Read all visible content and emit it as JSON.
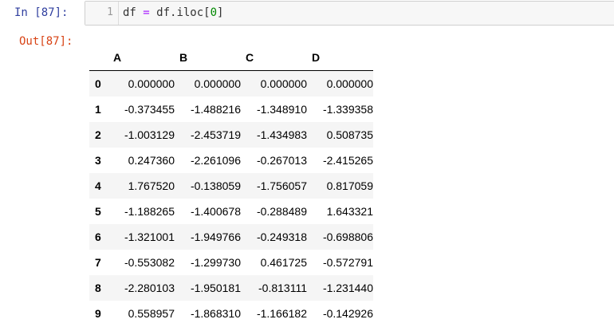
{
  "input_cell": {
    "prompt": "In  [87]:",
    "line_number": "1",
    "code": {
      "part1": "df ",
      "op": "=",
      "part2": " df.iloc[",
      "num": "0",
      "part3": "]"
    }
  },
  "output_cell": {
    "prompt": "Out[87]:",
    "dataframe": {
      "columns": [
        "A",
        "B",
        "C",
        "D"
      ],
      "rows": [
        {
          "index": "0",
          "values": [
            "0.000000",
            "0.000000",
            "0.000000",
            "0.000000"
          ]
        },
        {
          "index": "1",
          "values": [
            "-0.373455",
            "-1.488216",
            "-1.348910",
            "-1.339358"
          ]
        },
        {
          "index": "2",
          "values": [
            "-1.003129",
            "-2.453719",
            "-1.434983",
            "0.508735"
          ]
        },
        {
          "index": "3",
          "values": [
            "0.247360",
            "-2.261096",
            "-0.267013",
            "-2.415265"
          ]
        },
        {
          "index": "4",
          "values": [
            "1.767520",
            "-0.138059",
            "-1.756057",
            "0.817059"
          ]
        },
        {
          "index": "5",
          "values": [
            "-1.188265",
            "-1.400678",
            "-0.288489",
            "1.643321"
          ]
        },
        {
          "index": "6",
          "values": [
            "-1.321001",
            "-1.949766",
            "-0.249318",
            "-0.698806"
          ]
        },
        {
          "index": "7",
          "values": [
            "-0.553082",
            "-1.299730",
            "0.461725",
            "-0.572791"
          ]
        },
        {
          "index": "8",
          "values": [
            "-2.280103",
            "-1.950181",
            "-0.813111",
            "-1.231440"
          ]
        },
        {
          "index": "9",
          "values": [
            "0.558957",
            "-1.868310",
            "-1.166182",
            "-0.142926"
          ]
        }
      ]
    }
  }
}
